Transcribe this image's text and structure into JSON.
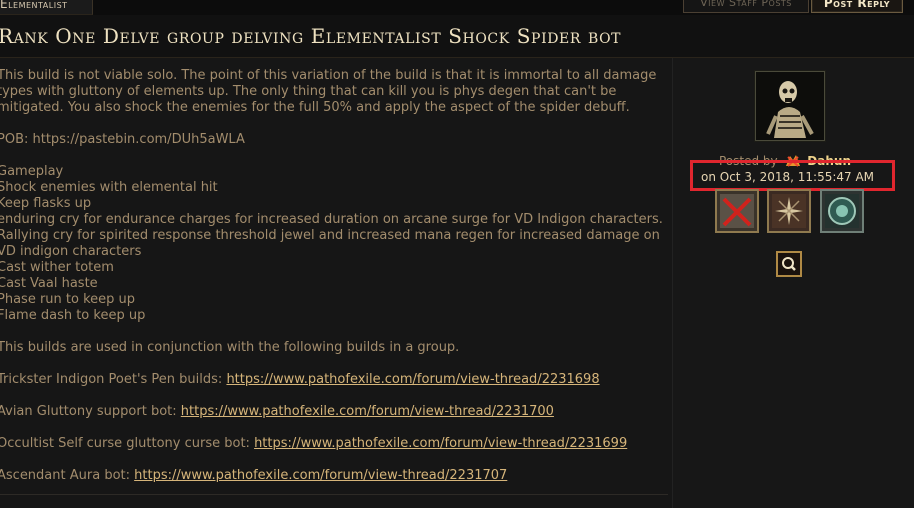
{
  "header": {
    "tab_label": "Elementalist",
    "view_staff_posts": "View Staff Posts",
    "post_reply": "Post Reply",
    "thread_title": "Rank One Delve group delving Elementalist Shock Spider bot"
  },
  "post": {
    "lines": [
      "This build is not viable solo. The point of this variation of the build is that it is immortal to all damage",
      "types with gluttony of elements up. The only thing that can kill you is phys degen that can't be",
      "mitigated. You also shock the enemies for the full 50% and apply the aspect of the spider debuff.",
      "",
      "POB: https://pastebin.com/DUh5aWLA",
      "",
      "Gameplay",
      "Shock enemies with elemental hit",
      "Keep flasks up",
      "enduring cry for endurance charges for increased duration on arcane surge for VD Indigon characters.",
      "Rallying cry for spirited response threshold jewel and increased mana regen for increased damage on",
      "VD indigon characters",
      "Cast wither totem",
      "Cast Vaal haste",
      "Phase run to keep up",
      "Flame dash to keep up",
      "",
      "This builds are used in conjunction with the following builds in a group."
    ],
    "links": [
      {
        "prefix": "Trickster Indigon Poet's Pen builds: ",
        "url": "https://www.pathofexile.com/forum/view-thread/2231698"
      },
      {
        "prefix": "Avian Gluttony support bot: ",
        "url": "https://www.pathofexile.com/forum/view-thread/2231700"
      },
      {
        "prefix": "Occultist Self curse gluttony curse bot: ",
        "url": "https://www.pathofexile.com/forum/view-thread/2231699"
      },
      {
        "prefix": "Ascendant Aura bot: ",
        "url": "https://www.pathofexile.com/forum/view-thread/2231707"
      }
    ]
  },
  "sidebar": {
    "posted_by_label": "Posted by",
    "author": "Dahun",
    "posted_on": "on Oct 3, 2018, 11:55:47 AM"
  },
  "colors": {
    "accent_text": "#efe2c1",
    "link": "#d6b57a",
    "highlight": "#e0262e"
  }
}
